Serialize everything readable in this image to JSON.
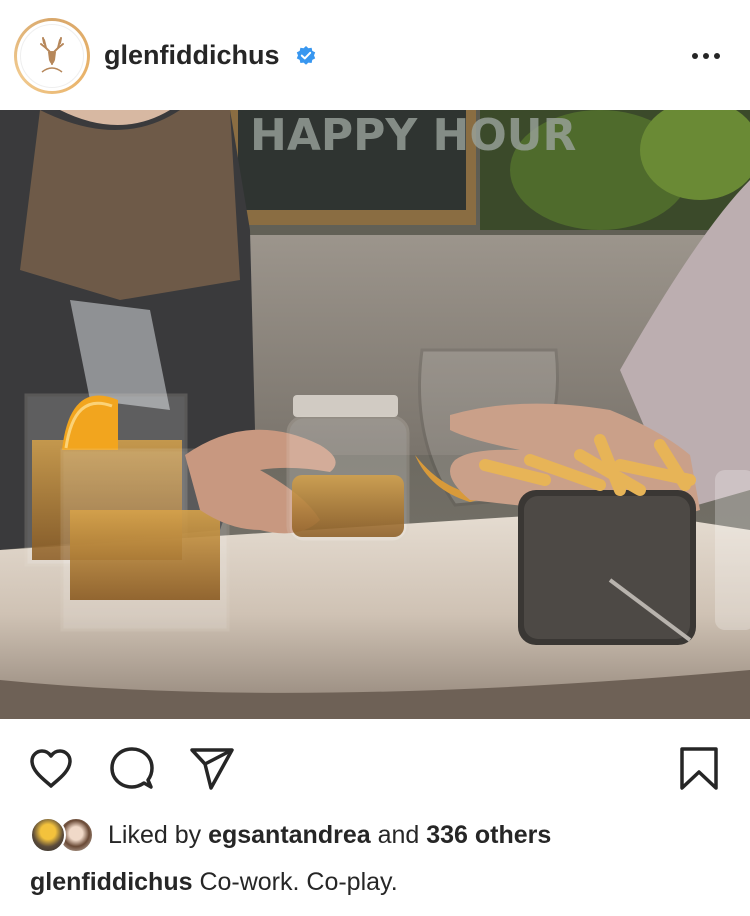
{
  "post": {
    "username": "glenfiddichus",
    "verified": true,
    "more_icon": "more-horizontal-icon",
    "brand_accent": "#3897f0"
  },
  "photo": {
    "sign_text": "HAPPY HOUR",
    "image": "photo of people toasting with whisky glasses and fries on a marble table"
  },
  "actions": {
    "like_icon": "heart-icon",
    "comment_icon": "comment-icon",
    "share_icon": "paper-plane-icon",
    "save_icon": "bookmark-icon"
  },
  "likes": {
    "prefix": "Liked by ",
    "liker": "egsantandrea",
    "conjunction": " and ",
    "others": "336 others"
  },
  "caption": {
    "username": "glenfiddichus",
    "text": " Co-work. Co-play."
  }
}
